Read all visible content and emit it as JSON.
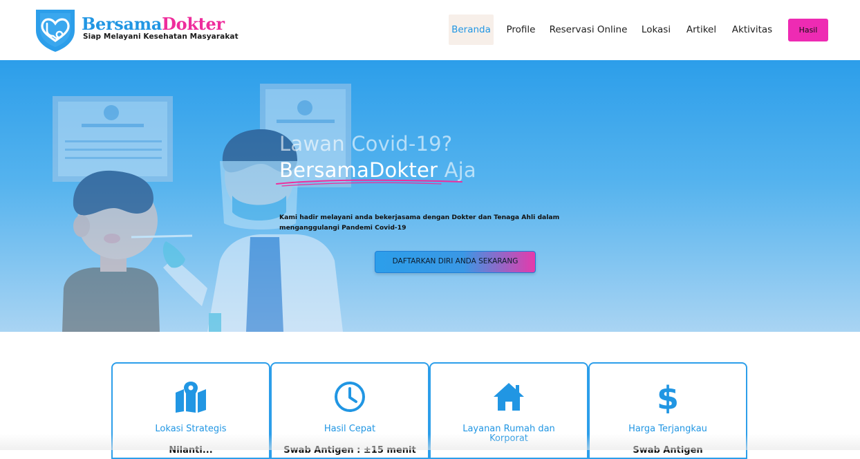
{
  "brand": {
    "name_part1": "Bersama",
    "name_part2": "Dokter",
    "tagline": "Siap Melayani Kesehatan Masyarakat",
    "primary_color": "#2196e3",
    "accent_color": "#ee2d9c"
  },
  "nav": {
    "items": [
      {
        "label": "Beranda",
        "active": true
      },
      {
        "label": "Profile",
        "active": false
      },
      {
        "label": "Reservasi Online",
        "active": false
      },
      {
        "label": "Lokasi",
        "active": false
      },
      {
        "label": "Artikel",
        "active": false
      },
      {
        "label": "Aktivitas",
        "active": false
      }
    ],
    "cta_label": "Hasil"
  },
  "hero": {
    "title_line1": "Lawan Covid-19?",
    "title_brand": "BersamaDokter",
    "title_tail": "Aja",
    "description": "Kami hadir melayani anda bekerjasama dengan Dokter dan Tenaga Ahli dalam menganggulangi Pandemi Covid-19",
    "cta_label": "DAFTARKAN DIRI ANDA SEKARANG"
  },
  "features": [
    {
      "icon": "map-marker-icon",
      "title": "Lokasi Strategis",
      "subtitle": "Nilanti..."
    },
    {
      "icon": "clock-icon",
      "title": "Hasil Cepat",
      "subtitle": "Swab Antigen : ±15 menit"
    },
    {
      "icon": "house-icon",
      "title": "Layanan Rumah dan Korporat",
      "subtitle": ""
    },
    {
      "icon": "dollar-icon",
      "title": "Harga Terjangkau",
      "subtitle": "Swab Antigen"
    }
  ]
}
